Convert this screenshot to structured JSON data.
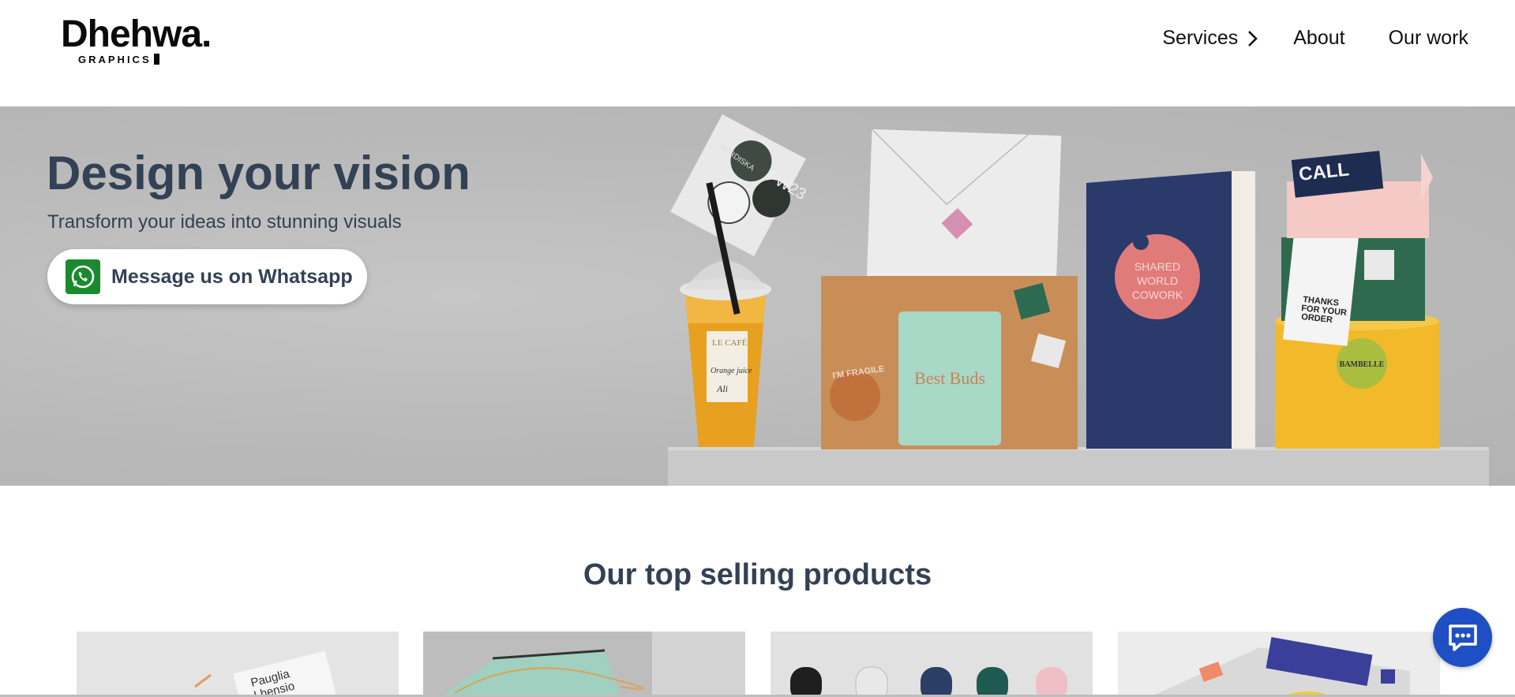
{
  "header": {
    "logo_text": "Dhehwa.",
    "logo_subtext": "GRAPHICS",
    "nav": {
      "services": "Services",
      "about": "About",
      "our_work": "Our work"
    }
  },
  "hero": {
    "title": "Design your vision",
    "subtitle": "Transform your ideas into stunning visuals",
    "whatsapp_button": "Message us on Whatsapp",
    "scene_text": {
      "cafe_label": "LE CAFÉ",
      "juice_label": "Orange juice",
      "juice_name": "Ali",
      "sticker_nordiska": "NORDISKA",
      "sticker_fw": "FW23",
      "fragile": "I'M FRAGILE",
      "card_title": "Best Buds",
      "book_circle": [
        "SHARED",
        "WORLD",
        "COWORK"
      ],
      "call_me": "CALL",
      "thanks": [
        "THANKS",
        "FOR YOUR",
        "ORDER"
      ],
      "bambelle": "BAMBELLE"
    }
  },
  "section": {
    "title": "Our top selling products",
    "card1_text": [
      "Pauglia",
      "Lhensio"
    ]
  },
  "colors": {
    "heading": "#334155",
    "whatsapp_green": "#1a8a2e",
    "chat_blue": "#1f4fc4"
  },
  "icons": {
    "chevron": "chevron-right-icon",
    "whatsapp": "whatsapp-icon",
    "chat": "chat-bubble-icon"
  }
}
